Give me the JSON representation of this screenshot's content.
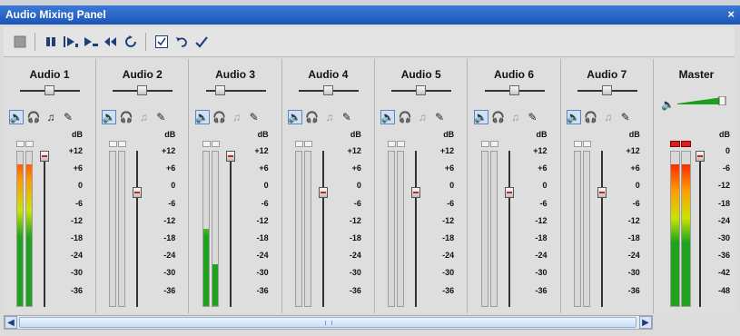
{
  "window": {
    "title": "Audio Mixing Panel",
    "close_glyph": "×"
  },
  "toolbar": {
    "buttons": [
      "stop-icon",
      "pause-icon",
      "play-range-icon",
      "play-selection-icon",
      "rewind-icon",
      "loop-icon",
      "checkbox-icon",
      "undo-icon",
      "apply-check-icon"
    ]
  },
  "channels": [
    {
      "name": "Audio 1",
      "pan": 0,
      "muted": true,
      "solo": false,
      "level_l": 0.92,
      "level_r": 0.92,
      "fader_db": 12,
      "icon_states": [
        "on",
        "normal",
        "normal",
        "normal"
      ]
    },
    {
      "name": "Audio 2",
      "pan": 0,
      "muted": true,
      "solo": false,
      "level_l": 0,
      "level_r": 0,
      "fader_db": 0,
      "icon_states": [
        "on",
        "normal",
        "dim",
        "normal"
      ]
    },
    {
      "name": "Audio 3",
      "pan": -0.6,
      "muted": true,
      "solo": false,
      "level_l": 0.5,
      "level_r": 0.27,
      "fader_db": 12,
      "icon_states": [
        "on",
        "normal",
        "dim",
        "normal"
      ]
    },
    {
      "name": "Audio 4",
      "pan": 0,
      "muted": true,
      "solo": false,
      "level_l": 0,
      "level_r": 0,
      "fader_db": 0,
      "icon_states": [
        "on",
        "normal",
        "dim",
        "normal"
      ]
    },
    {
      "name": "Audio 5",
      "pan": 0,
      "muted": true,
      "solo": false,
      "level_l": 0,
      "level_r": 0,
      "fader_db": 0,
      "icon_states": [
        "on",
        "normal",
        "dim",
        "normal"
      ]
    },
    {
      "name": "Audio 6",
      "pan": 0,
      "muted": true,
      "solo": false,
      "level_l": 0,
      "level_r": 0,
      "fader_db": 0,
      "icon_states": [
        "on",
        "normal",
        "dim",
        "normal"
      ]
    },
    {
      "name": "Audio 7",
      "pan": 0,
      "muted": true,
      "solo": false,
      "level_l": 0,
      "level_r": 0,
      "fader_db": 0,
      "icon_states": [
        "on",
        "normal",
        "dim",
        "normal"
      ]
    }
  ],
  "db_unit": "dB",
  "channel_scale": [
    "+12",
    "+6",
    "0",
    "-6",
    "-12",
    "-18",
    "-24",
    "-30",
    "-36"
  ],
  "master": {
    "name": "Master",
    "volume": 1.0,
    "level_l": 0.92,
    "level_r": 0.92,
    "fader_db": 0,
    "scale": [
      "0",
      "-6",
      "-12",
      "-18",
      "-24",
      "-30",
      "-36",
      "-42",
      "-48"
    ],
    "clip_red": true
  },
  "colors": {
    "meter_top": "#ff2a00",
    "meter_upper": "#ff9a00",
    "meter_mid": "#c9e400",
    "meter_low": "#1fa31f",
    "accent": "#2b62c5"
  }
}
